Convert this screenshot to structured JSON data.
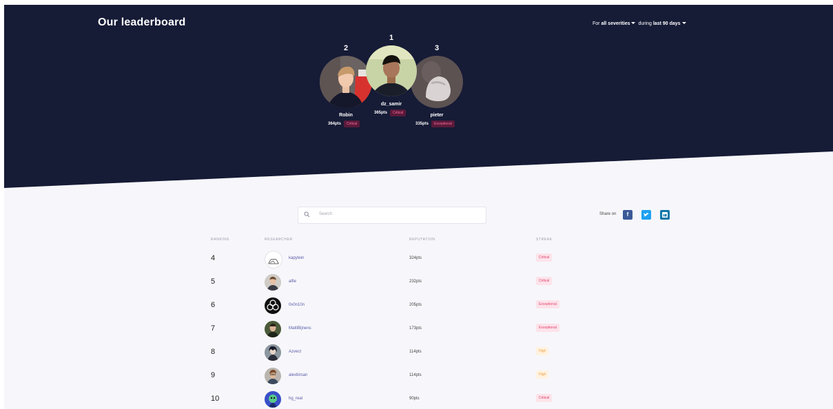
{
  "hero": {
    "title": "Our leaderboard",
    "filter": {
      "prefix": "For",
      "severity": "all severities",
      "middle": "during",
      "period": "last 90 days"
    },
    "podium": [
      {
        "rank": "2",
        "name": "Robin",
        "points": "364pts",
        "streak": "Critical"
      },
      {
        "rank": "1",
        "name": "dz_samir",
        "points": "365pts",
        "streak": "Critical"
      },
      {
        "rank": "3",
        "name": "pieter",
        "points": "335pts",
        "streak": "Exceptional"
      }
    ]
  },
  "search": {
    "placeholder": "Search"
  },
  "share": {
    "label": "Share on",
    "facebook": "f",
    "twitter": "t",
    "linkedin": "in"
  },
  "table": {
    "headers": [
      "RANKING",
      "RESEARCHER",
      "REPUTATION",
      "STREAK"
    ],
    "rows": [
      {
        "rank": "4",
        "name": "kapytein",
        "points": "324pts",
        "streak": "Critical"
      },
      {
        "rank": "5",
        "name": "alfie",
        "points": "232pts",
        "streak": "Critical"
      },
      {
        "rank": "6",
        "name": "0x0n10n",
        "points": "205pts",
        "streak": "Exceptional"
      },
      {
        "rank": "7",
        "name": "MattiBijnens",
        "points": "173pts",
        "streak": "Exceptional"
      },
      {
        "rank": "8",
        "name": "Azvect",
        "points": "114pts",
        "streak": "High"
      },
      {
        "rank": "9",
        "name": "alexbirsan",
        "points": "114pts",
        "streak": "High"
      },
      {
        "rank": "10",
        "name": "hg_real",
        "points": "90pts",
        "streak": "Critical"
      }
    ]
  },
  "colors": {
    "hero_bg": "#161b36",
    "page_bg": "#f7f7fb",
    "critical": "#e0436e",
    "high": "#f0a043",
    "facebook": "#3b5998",
    "twitter": "#1da1f2",
    "linkedin": "#0e76a8"
  }
}
